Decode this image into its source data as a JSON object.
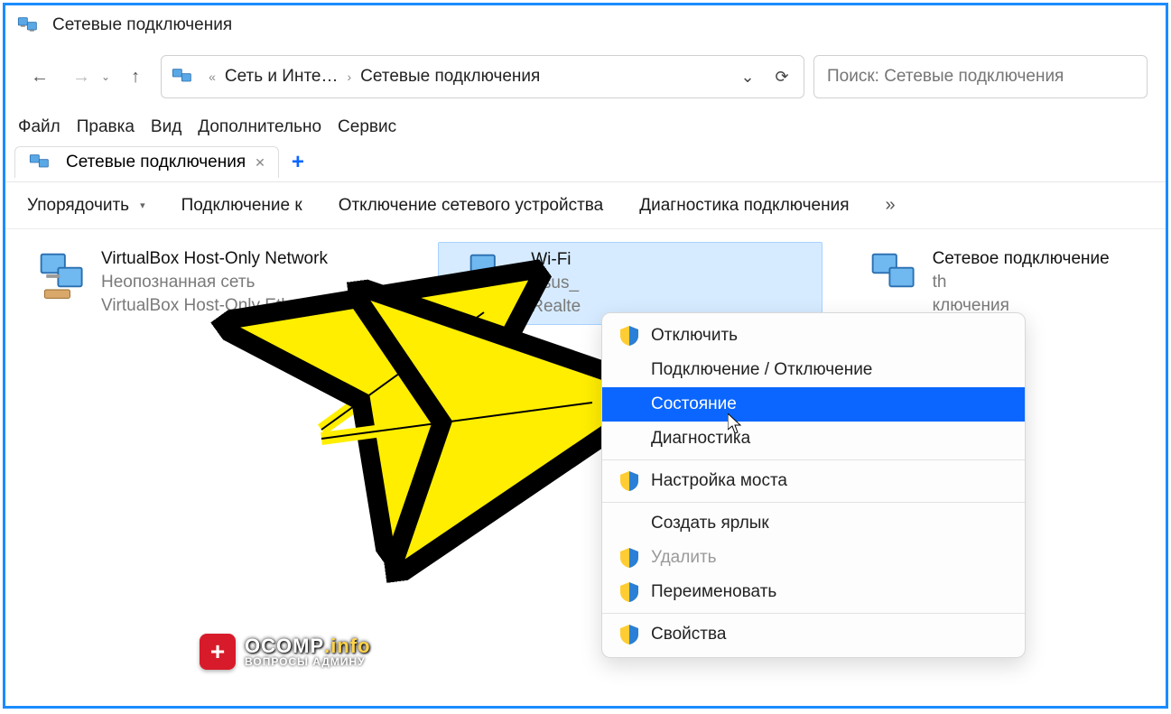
{
  "window": {
    "title": "Сетевые подключения"
  },
  "breadcrumbs": {
    "a": "Сеть и Инте…",
    "b": "Сетевые подключения"
  },
  "search": {
    "placeholder": "Поиск: Сетевые подключения"
  },
  "menubar": {
    "file": "Файл",
    "edit": "Правка",
    "view": "Вид",
    "extra": "Дополнительно",
    "service": "Сервис"
  },
  "tab": {
    "label": "Сетевые подключения"
  },
  "toolbar": {
    "organize": "Упорядочить",
    "connect": "Подключение к",
    "disable": "Отключение сетевого устройства",
    "diag": "Диагностика подключения",
    "overflow": "»"
  },
  "connections": [
    {
      "name": "VirtualBox Host-Only Network",
      "sub1": "Неопознанная сеть",
      "sub2": "VirtualBox Host-Only Ethernet…"
    },
    {
      "name": "Wi-Fi",
      "sub1": "Asus_",
      "sub2": "Realte"
    },
    {
      "name": "Сетевое подключение",
      "sub1": "th",
      "sub2": "ключения"
    }
  ],
  "ctx": {
    "disable": "Отключить",
    "connDisc": "Подключение / Отключение",
    "status": "Состояние",
    "diag": "Диагностика",
    "bridge": "Настройка моста",
    "shortcut": "Создать ярлык",
    "delete": "Удалить",
    "rename": "Переименовать",
    "props": "Свойства"
  },
  "watermark": {
    "brand": "OCOMP",
    "tld": ".info",
    "sub": "ВОПРОСЫ АДМИНУ"
  }
}
